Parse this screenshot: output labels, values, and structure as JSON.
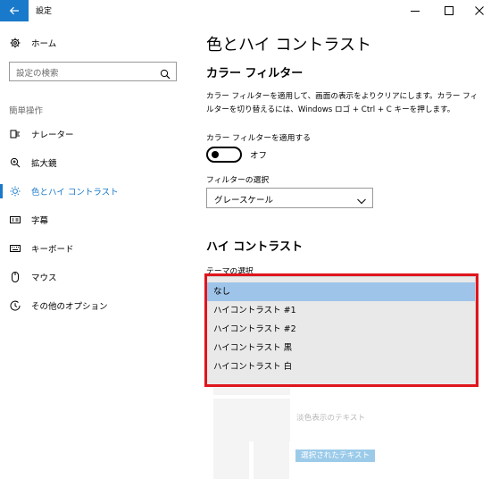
{
  "window": {
    "title": "設定",
    "back_icon": "back-arrow-icon",
    "minimize_icon": "minimize-icon",
    "maximize_icon": "maximize-icon",
    "close_icon": "close-icon"
  },
  "sidebar": {
    "home_label": "ホーム",
    "search_placeholder": "設定の検索",
    "section_label": "簡単操作",
    "items": [
      {
        "label": "ナレーター",
        "icon": "narrator-icon"
      },
      {
        "label": "拡大鏡",
        "icon": "magnifier-icon"
      },
      {
        "label": "色とハイ コントラスト",
        "icon": "color-contrast-icon",
        "active": true
      },
      {
        "label": "字幕",
        "icon": "closed-captions-icon"
      },
      {
        "label": "キーボード",
        "icon": "keyboard-icon"
      },
      {
        "label": "マウス",
        "icon": "mouse-icon"
      },
      {
        "label": "その他のオプション",
        "icon": "other-options-icon"
      }
    ]
  },
  "main": {
    "title": "色とハイ コントラスト",
    "color_filter": {
      "heading": "カラー フィルター",
      "description": "カラー フィルターを適用して、画面の表示をよりクリアにします。カラー フィルターを切り替えるには、Windows ロゴ + Ctrl + C キーを押します。",
      "toggle_label": "カラー フィルターを適用する",
      "toggle_state": "オフ",
      "filter_label": "フィルターの選択",
      "filter_value": "グレースケール"
    },
    "high_contrast": {
      "heading": "ハイ コントラスト",
      "theme_label": "テーマの選択",
      "options": [
        "なし",
        "ハイコントラスト #1",
        "ハイコントラスト #2",
        "ハイコントラスト 黒",
        "ハイコントラスト 白"
      ],
      "selected_index": 0,
      "preview_text": "淡色表示のテキスト",
      "preview_selected_text": "選択されたテキスト"
    }
  },
  "colors": {
    "accent": "#1979ca",
    "selected_option": "#9ec4e9",
    "highlight_frame": "#e0151d"
  }
}
